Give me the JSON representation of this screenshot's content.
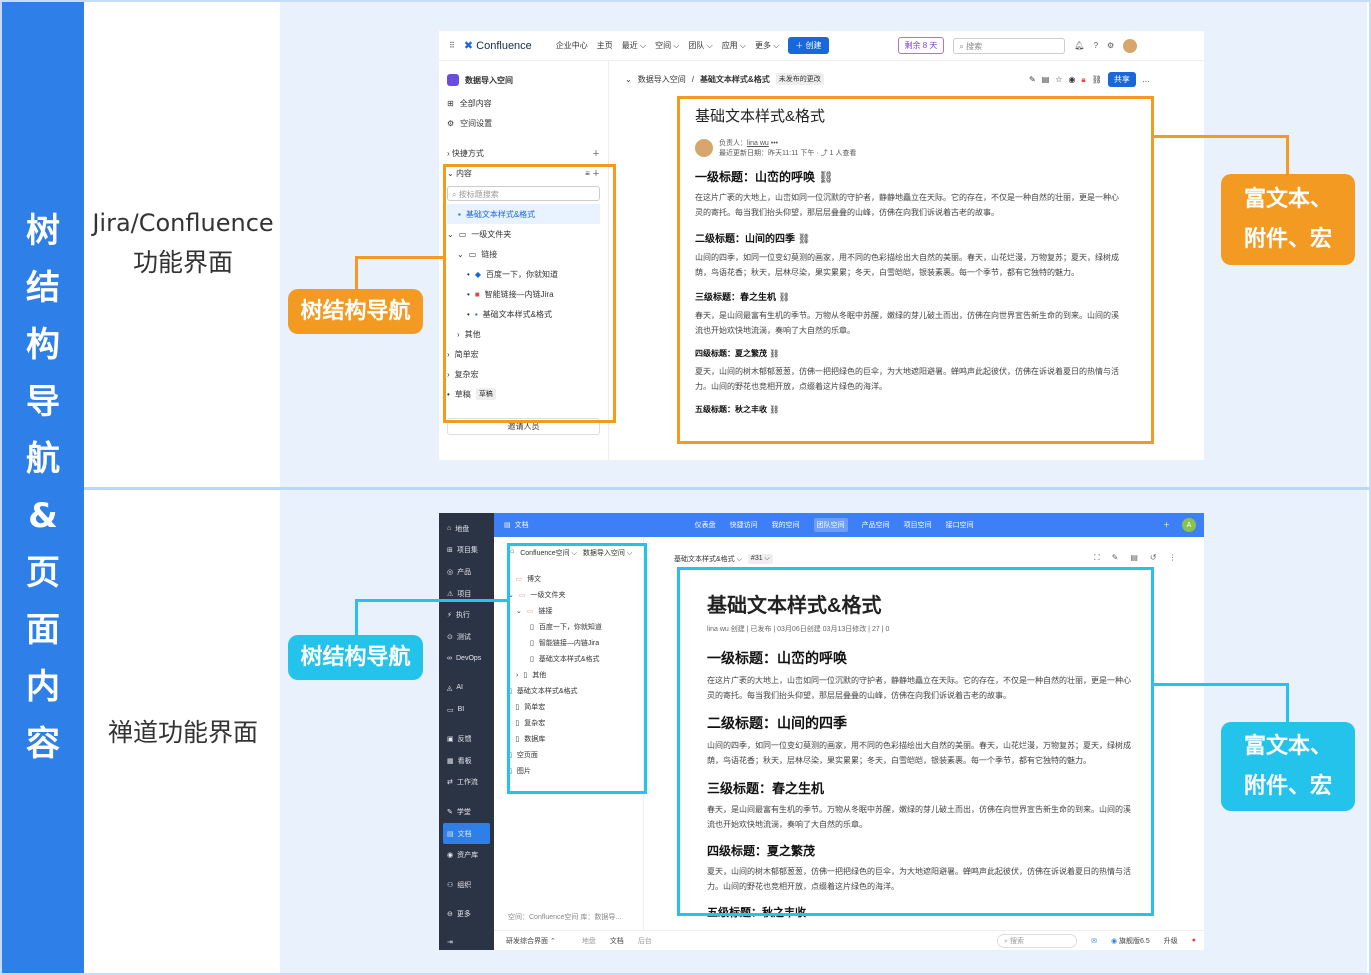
{
  "left_band": {
    "chars": [
      "树",
      "结",
      "构",
      "导",
      "航",
      "&",
      "页",
      "面",
      "内",
      "容"
    ]
  },
  "row1": {
    "label_line1": "Jira/Confluence",
    "label_line2": "功能界面"
  },
  "row2": {
    "label": "禅道功能界面"
  },
  "tags": {
    "tree_nav": "树结构导航",
    "rich_line1": "富文本、",
    "rich_line2": "附件、宏"
  },
  "confluence": {
    "logo": "Confluence",
    "nav": [
      "企业中心",
      "主页",
      "最近 ⌵",
      "空间 ⌵",
      "团队 ⌵",
      "应用 ⌵",
      "更多 ⌵"
    ],
    "create": "＋ 创建",
    "trial": "剩余 8 天",
    "search_placeholder": "搜索",
    "space_name": "数据导入空间",
    "sidebar_links": [
      "全部内容",
      "空间设置"
    ],
    "shortcuts": "快捷方式",
    "content_label": "内容",
    "filter_placeholder": "按标题搜索",
    "tree": [
      "基础文本样式&格式",
      "一级文件夹",
      "链接",
      "百度一下，你就知道",
      "智能链接—内链Jira",
      "基础文本样式&格式",
      "其他",
      "简单宏",
      "复杂宏",
      "草稿"
    ],
    "draft_badge": "草稿",
    "invite": "邀请人员",
    "breadcrumb": [
      "数据导入空间",
      "/",
      "基础文本样式&格式"
    ],
    "unpublished": "未发布的更改",
    "share": "共享",
    "title": "基础文本样式&格式",
    "owner_label": "负责人：",
    "owner": "lina wu",
    "updated": "最近更新日期：昨天11:11 下午 · ⤴ 1 人查看",
    "h1": "一级标题：山峦的呼唤",
    "p1": "在这片广袤的大地上，山峦如同一位沉默的守护者，静静地矗立在天际。它的存在，不仅是一种自然的壮丽，更是一种心灵的寄托。每当我们抬头仰望，那层层叠叠的山峰，仿佛在向我们诉说着古老的故事。",
    "h2": "二级标题：山间的四季",
    "p2": "山间的四季，如同一位变幻莫测的画家，用不同的色彩描绘出大自然的美丽。春天，山花烂漫，万物复苏；夏天，绿树成荫，鸟语花香；秋天，层林尽染，果实累累；冬天，白雪皑皑，银装素裹。每一个季节，都有它独特的魅力。",
    "h3": "三级标题：春之生机",
    "p3": "春天，是山间最富有生机的季节。万物从冬眠中苏醒，嫩绿的芽儿破土而出，仿佛在向世界宣告新生命的到来。山间的溪流也开始欢快地流淌，奏响了大自然的乐章。",
    "h4": "四级标题：夏之繁茂",
    "p4": "夏天，山间的树木郁郁葱葱，仿佛一把把绿色的巨伞，为大地遮阳避暑。蝉鸣声此起彼伏，仿佛在诉说着夏日的热情与活力。山间的野花也竞相开放，点缀着这片绿色的海洋。",
    "h5": "五级标题：秋之丰收"
  },
  "zentao": {
    "side": [
      "地盘",
      "项目集",
      "产品",
      "项目",
      "执行",
      "测试",
      "DevOps",
      "AI",
      "BI",
      "反馈",
      "看板",
      "工作流",
      "学堂",
      "文档",
      "资产库",
      "组织",
      "更多"
    ],
    "module": "文档",
    "tabs": [
      "仪表盘",
      "快捷访问",
      "我的空间",
      "团队空间",
      "产品空间",
      "项目空间",
      "接口空间"
    ],
    "avatar": "A",
    "breadcrumb": [
      "Confluence空间 ⌵",
      "数据导入空间 ⌵",
      "基础文本样式&格式 ⌵",
      "#31 ⌵"
    ],
    "tree": [
      "博文",
      "一级文件夹",
      "链接",
      "百度一下，你就知道",
      "智能链接—内链Jira",
      "基础文本样式&格式",
      "其他",
      "基础文本样式&格式",
      "简单宏",
      "复杂宏",
      "数据库",
      "空页面",
      "图片"
    ],
    "footer_space": "空间：Confluence空间 库：数据导...",
    "title": "基础文本样式&格式",
    "meta": "lina wu 创建 | 已发布 | 03月06日创建 03月13日修改 | 27 | 0",
    "bottom": [
      "研发综合界面 ⌃",
      "地盘",
      "文档",
      "后台"
    ],
    "bottom_search": "搜索",
    "version": "旗舰版6.5",
    "upgrade": "升级"
  }
}
